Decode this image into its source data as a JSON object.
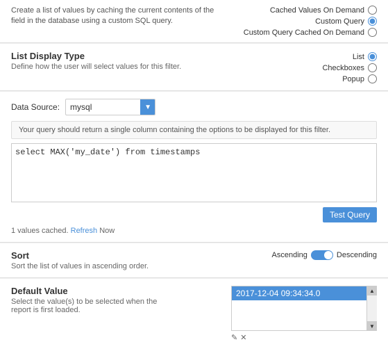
{
  "top": {
    "description": "Create a list of values by caching the current contents of the field in the database using a custom SQL query.",
    "radio_options": [
      {
        "label": "Cached Values On Demand",
        "value": "cached_on_demand",
        "checked": false
      },
      {
        "label": "Custom Query",
        "value": "custom_query",
        "checked": true
      },
      {
        "label": "Custom Query Cached On Demand",
        "value": "custom_cached",
        "checked": false
      }
    ]
  },
  "list_display": {
    "title": "List Display Type",
    "description": "Define how the user will select values for this filter.",
    "options": [
      {
        "label": "List",
        "checked": true
      },
      {
        "label": "Checkboxes",
        "checked": false
      },
      {
        "label": "Popup",
        "checked": false
      }
    ]
  },
  "query": {
    "datasource_label": "Data Source:",
    "datasource_value": "mysql",
    "datasource_arrow": "▼",
    "hint": "Your query should return a single column containing the options to be displayed for this filter.",
    "query_text": "select MAX('my_date') from timestamps",
    "test_query_label": "Test Query",
    "cache_info": "1 values cached.",
    "refresh_label": "Refresh",
    "now_label": "Now"
  },
  "sort": {
    "title": "Sort",
    "description": "Sort the list of values in ascending order.",
    "ascending_label": "Ascending",
    "descending_label": "Descending"
  },
  "default_value": {
    "title": "Default Value",
    "description": "Select the value(s) to be selected when the report is first loaded.",
    "list_items": [
      {
        "label": "2017-12-04 09:34:34.0",
        "selected": true
      }
    ],
    "scroll_up": "▲",
    "scroll_down": "▼",
    "action_add": "✎",
    "action_remove": "✕"
  }
}
